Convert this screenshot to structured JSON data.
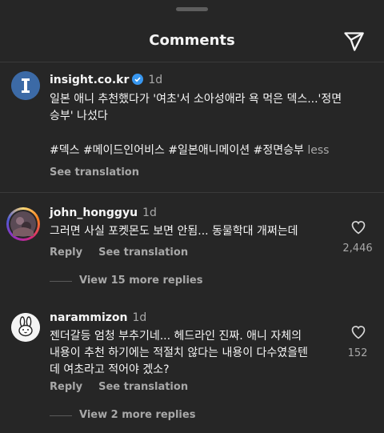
{
  "header": {
    "title": "Comments",
    "share_icon": "paper-plane-icon"
  },
  "post": {
    "username": "insight.co.kr",
    "time": "1d",
    "caption_line1": "일본 애니 추천했다가 '여초'서 소아성애라 욕 먹은 덱스...'정면",
    "caption_line2": "승부' 나섰다",
    "hashtags": "#덱스 #메이드인어비스 #일본애니메이션 #정면승부",
    "less_label": "less",
    "see_translation": "See translation"
  },
  "comments": [
    {
      "username": "john_honggyu",
      "time": "1d",
      "text_line1": "그러면 사실 포켓몬도 보면 안됨... 동물학대 개쩌는데",
      "reply_label": "Reply",
      "see_translation": "See translation",
      "likes": "2,446",
      "more_replies": "View 15 more replies"
    },
    {
      "username": "narammizon",
      "time": "1d",
      "text_line1": "젠더갈등 엄청 부추기네... 헤드라인 진짜. 애니 자체의",
      "text_line2": "내용이 추천 하기에는 적절치 않다는 내용이 다수였을텐",
      "text_line3": "데 여초라고 적어야 겠소?",
      "reply_label": "Reply",
      "see_translation": "See translation",
      "likes": "152",
      "more_replies": "View 2 more replies"
    }
  ]
}
